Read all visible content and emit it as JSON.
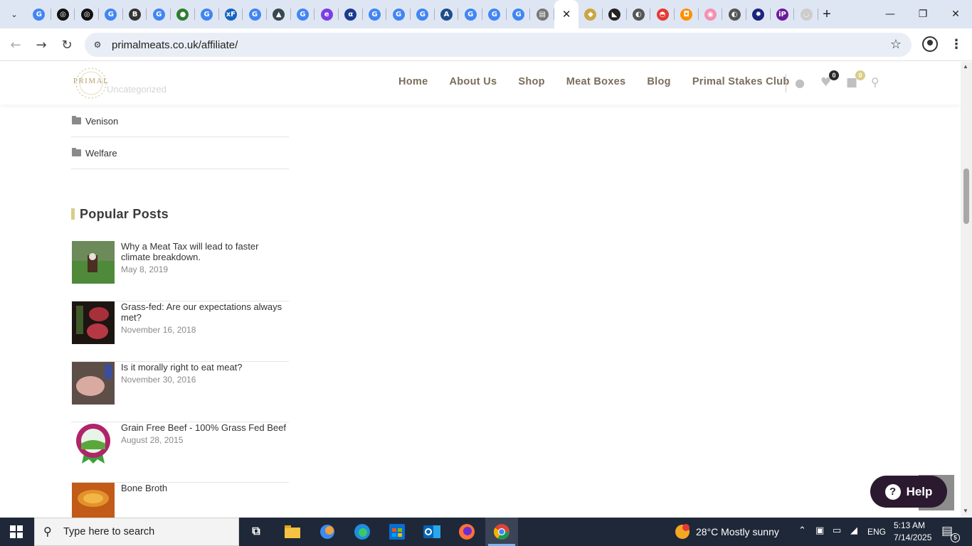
{
  "browser": {
    "url": "primalmeats.co.uk/affiliate/",
    "tab_close_glyph": "✕",
    "new_tab_glyph": "+",
    "tabs": [
      {
        "icon": "google-icon",
        "color": "#4285f4",
        "glyph": "G"
      },
      {
        "icon": "chatgpt-icon",
        "color": "#111111",
        "glyph": "◎"
      },
      {
        "icon": "chatgpt-icon",
        "color": "#111111",
        "glyph": "◎"
      },
      {
        "icon": "google-icon",
        "color": "#4285f4",
        "glyph": "G"
      },
      {
        "icon": "b-icon",
        "color": "#333333",
        "glyph": "B"
      },
      {
        "icon": "google-icon",
        "color": "#4285f4",
        "glyph": "G"
      },
      {
        "icon": "green-globe-icon",
        "color": "#2e7d32",
        "glyph": "●"
      },
      {
        "icon": "google-icon",
        "color": "#4285f4",
        "glyph": "G"
      },
      {
        "icon": "xf-icon",
        "color": "#1565c0",
        "glyph": "xF"
      },
      {
        "icon": "google-icon",
        "color": "#4285f4",
        "glyph": "G"
      },
      {
        "icon": "graduation-cap-icon",
        "color": "#37474f",
        "glyph": "▲"
      },
      {
        "icon": "google-icon",
        "color": "#4285f4",
        "glyph": "G"
      },
      {
        "icon": "e-icon",
        "color": "#7b3fe4",
        "glyph": "e"
      },
      {
        "icon": "alpha-icon",
        "color": "#1a3c8f",
        "glyph": "α"
      },
      {
        "icon": "google-icon",
        "color": "#4285f4",
        "glyph": "G"
      },
      {
        "icon": "google-icon",
        "color": "#4285f4",
        "glyph": "G"
      },
      {
        "icon": "google-icon",
        "color": "#4285f4",
        "glyph": "G"
      },
      {
        "icon": "aa-icon",
        "color": "#1e4e8c",
        "glyph": "A"
      },
      {
        "icon": "google-icon",
        "color": "#4285f4",
        "glyph": "G"
      },
      {
        "icon": "google-icon",
        "color": "#4285f4",
        "glyph": "G"
      },
      {
        "icon": "google-icon",
        "color": "#4285f4",
        "glyph": "G"
      },
      {
        "icon": "cart-icon",
        "color": "#777777",
        "glyph": "▤"
      },
      {
        "icon": "primal-meats-icon",
        "color": "#ffffff",
        "glyph": "",
        "active": true
      },
      {
        "icon": "shield-icon",
        "color": "#c9a646",
        "glyph": "◆"
      },
      {
        "icon": "cat-icon",
        "color": "#222222",
        "glyph": "◣"
      },
      {
        "icon": "globe-icon",
        "color": "#555555",
        "glyph": "◐"
      },
      {
        "icon": "red-icon",
        "color": "#e53935",
        "glyph": "◓"
      },
      {
        "icon": "orange-box-icon",
        "color": "#ff8f00",
        "glyph": "◘"
      },
      {
        "icon": "gradient-icon",
        "color": "#f48fb1",
        "glyph": "◉"
      },
      {
        "icon": "globe-icon",
        "color": "#555555",
        "glyph": "◐"
      },
      {
        "icon": "gear-icon",
        "color": "#1a237e",
        "glyph": "✹"
      },
      {
        "icon": "ip-icon",
        "color": "#6a1b9a",
        "glyph": "iP"
      },
      {
        "icon": "face-icon",
        "color": "#cccccc",
        "glyph": "◡"
      }
    ]
  },
  "site": {
    "logo_text": "PRIMAL",
    "ghost_text": "Uncategorized",
    "nav": [
      "Home",
      "About Us",
      "Shop",
      "Meat Boxes",
      "Blog",
      "Primal Stakes Club"
    ],
    "wishlist_count": "0",
    "cart_count": "0",
    "accent_color": "#d8cd8a"
  },
  "sidebar": {
    "categories": [
      "Venison",
      "Welfare"
    ],
    "popular_title": "Popular Posts",
    "posts": [
      {
        "title": "Why a Meat Tax will lead to faster climate breakdown.",
        "date": "May 8, 2019"
      },
      {
        "title": "Grass-fed: Are our expectations always met?",
        "date": "November 16, 2018"
      },
      {
        "title": "Is it morally right to eat meat?",
        "date": "November 30, 2016"
      },
      {
        "title": "Grain Free Beef - 100% Grass Fed Beef",
        "date": "August 28, 2015"
      },
      {
        "title": "Bone Broth",
        "date": ""
      }
    ]
  },
  "help": {
    "label": "Help",
    "glyph": "?"
  },
  "taskbar": {
    "search_placeholder": "Type here to search",
    "weather": "28°C  Mostly sunny",
    "language": "ENG",
    "time": "5:13 AM",
    "date": "7/14/2025",
    "notification_count": "5"
  }
}
